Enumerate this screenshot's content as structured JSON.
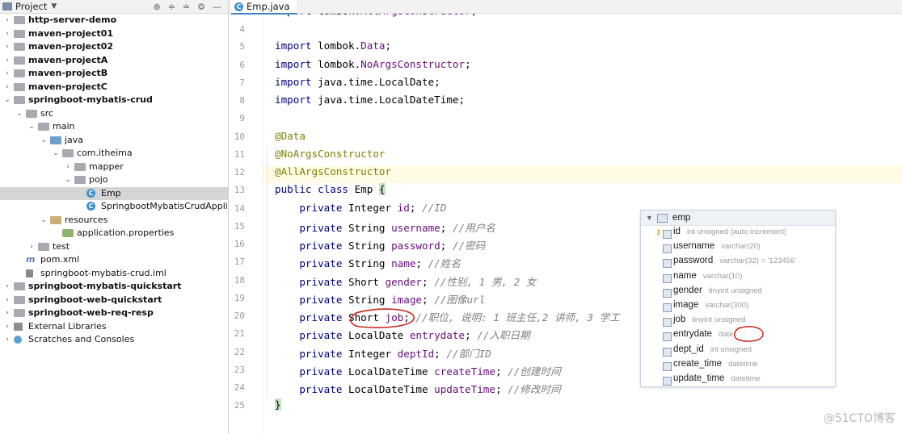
{
  "project_panel": {
    "title": "Project",
    "tree": [
      {
        "label": "http-server-demo",
        "bold": true,
        "icon": "folder-icon",
        "arrow": "right"
      },
      {
        "label": "maven-project01",
        "bold": true,
        "icon": "folder-icon",
        "arrow": "right"
      },
      {
        "label": "maven-project02",
        "bold": true,
        "icon": "folder-icon",
        "arrow": "right"
      },
      {
        "label": "maven-projectA",
        "bold": true,
        "icon": "folder-icon",
        "arrow": "right"
      },
      {
        "label": "maven-projectB",
        "bold": true,
        "icon": "folder-icon",
        "arrow": "right"
      },
      {
        "label": "maven-projectC",
        "bold": true,
        "icon": "folder-icon",
        "arrow": "right"
      },
      {
        "label": "springboot-mybatis-crud",
        "bold": true,
        "icon": "folder-icon",
        "arrow": "down"
      },
      {
        "label": "src",
        "icon": "folder-icon",
        "arrow": "down"
      },
      {
        "label": "main",
        "icon": "folder-icon",
        "arrow": "down"
      },
      {
        "label": "java",
        "icon": "source-folder-icon",
        "arrow": "down"
      },
      {
        "label": "com.itheima",
        "icon": "package-icon",
        "arrow": "down"
      },
      {
        "label": "mapper",
        "icon": "package-icon",
        "arrow": "right"
      },
      {
        "label": "pojo",
        "icon": "package-icon",
        "arrow": "down"
      },
      {
        "label": "Emp",
        "icon": "class-icon",
        "arrow": "",
        "selected": true
      },
      {
        "label": "SpringbootMybatisCrudApplication",
        "icon": "class-icon",
        "arrow": ""
      },
      {
        "label": "resources",
        "icon": "resources-folder-icon",
        "arrow": "down"
      },
      {
        "label": "application.properties",
        "icon": "properties-file-icon",
        "arrow": ""
      },
      {
        "label": "test",
        "icon": "folder-icon",
        "arrow": "right"
      },
      {
        "label": "pom.xml",
        "icon": "maven-file-icon",
        "arrow": ""
      },
      {
        "label": "springboot-mybatis-crud.iml",
        "icon": "iml-file-icon",
        "arrow": ""
      },
      {
        "label": "springboot-mybatis-quickstart",
        "bold": true,
        "icon": "folder-icon",
        "arrow": "right"
      },
      {
        "label": "springboot-web-quickstart",
        "bold": true,
        "icon": "folder-icon",
        "arrow": "right"
      },
      {
        "label": "springboot-web-req-resp",
        "bold": true,
        "icon": "folder-icon",
        "arrow": "right"
      },
      {
        "label": "External Libraries",
        "icon": "library-icon",
        "arrow": "right"
      },
      {
        "label": "Scratches and Consoles",
        "icon": "scratch-icon",
        "arrow": "right"
      }
    ]
  },
  "editor": {
    "tab_label": "Emp.java",
    "line_numbers": [
      "4",
      "5",
      "6",
      "7",
      "8",
      "9",
      "10",
      "11",
      "12",
      "13",
      "14",
      "15",
      "16",
      "17",
      "18",
      "19",
      "20",
      "21",
      "22",
      "23",
      "24",
      "25"
    ],
    "lines": [
      [
        {
          "t": "import lombok.",
          "c": "kw0"
        },
        {
          "t": "AllArgsConstructor",
          "c": "pk"
        },
        {
          "t": ";",
          "c": ""
        }
      ],
      [
        {
          "t": "import",
          "c": "kw"
        },
        {
          "t": " lombok.",
          "c": ""
        },
        {
          "t": "Data",
          "c": "pk"
        },
        {
          "t": ";",
          "c": ""
        }
      ],
      [
        {
          "t": "import",
          "c": "kw"
        },
        {
          "t": " lombok.",
          "c": ""
        },
        {
          "t": "NoArgsConstructor",
          "c": "pk"
        },
        {
          "t": ";",
          "c": ""
        }
      ],
      [
        {
          "t": "import",
          "c": "kw"
        },
        {
          "t": " java.time.LocalDate;",
          "c": ""
        }
      ],
      [
        {
          "t": "import",
          "c": "kw"
        },
        {
          "t": " java.time.LocalDateTime;",
          "c": ""
        }
      ],
      [],
      [
        {
          "t": "@Data",
          "c": "ann"
        }
      ],
      [
        {
          "t": "@NoArgsConstructor",
          "c": "ann"
        }
      ],
      [
        {
          "t": "@AllArgsConstructor",
          "c": "ann"
        }
      ],
      [
        {
          "t": "public class",
          "c": "kw"
        },
        {
          "t": " Emp ",
          "c": ""
        },
        {
          "t": "{",
          "c": "brace-hl"
        }
      ],
      [
        {
          "t": "    private",
          "c": "kw"
        },
        {
          "t": " Integer ",
          "c": ""
        },
        {
          "t": "id",
          "c": "fld"
        },
        {
          "t": "; ",
          "c": ""
        },
        {
          "t": "//ID",
          "c": "cmt"
        }
      ],
      [
        {
          "t": "    private",
          "c": "kw"
        },
        {
          "t": " String ",
          "c": ""
        },
        {
          "t": "username",
          "c": "fld"
        },
        {
          "t": "; ",
          "c": ""
        },
        {
          "t": "//用户名",
          "c": "cmt"
        }
      ],
      [
        {
          "t": "    private",
          "c": "kw"
        },
        {
          "t": " String ",
          "c": ""
        },
        {
          "t": "password",
          "c": "fld"
        },
        {
          "t": "; ",
          "c": ""
        },
        {
          "t": "//密码",
          "c": "cmt"
        }
      ],
      [
        {
          "t": "    private",
          "c": "kw"
        },
        {
          "t": " String ",
          "c": ""
        },
        {
          "t": "name",
          "c": "fld"
        },
        {
          "t": "; ",
          "c": ""
        },
        {
          "t": "//姓名",
          "c": "cmt"
        }
      ],
      [
        {
          "t": "    private",
          "c": "kw"
        },
        {
          "t": " Short ",
          "c": ""
        },
        {
          "t": "gender",
          "c": "fld"
        },
        {
          "t": "; ",
          "c": ""
        },
        {
          "t": "//性别, 1 男, 2 女",
          "c": "cmt"
        }
      ],
      [
        {
          "t": "    private",
          "c": "kw"
        },
        {
          "t": " String ",
          "c": ""
        },
        {
          "t": "image",
          "c": "fld"
        },
        {
          "t": "; ",
          "c": ""
        },
        {
          "t": "//图像url",
          "c": "cmt"
        }
      ],
      [
        {
          "t": "    private",
          "c": "kw"
        },
        {
          "t": " Short ",
          "c": ""
        },
        {
          "t": "job",
          "c": "fld"
        },
        {
          "t": "; ",
          "c": ""
        },
        {
          "t": "//职位, 说明: 1 班主任,2 讲师, 3 学工",
          "c": "cmt"
        }
      ],
      [
        {
          "t": "    private",
          "c": "kw"
        },
        {
          "t": " LocalDate ",
          "c": ""
        },
        {
          "t": "entrydate",
          "c": "fld"
        },
        {
          "t": "; ",
          "c": ""
        },
        {
          "t": "//入职日期",
          "c": "cmt"
        }
      ],
      [
        {
          "t": "    private",
          "c": "kw"
        },
        {
          "t": " Integer ",
          "c": ""
        },
        {
          "t": "deptId",
          "c": "fld"
        },
        {
          "t": "; ",
          "c": ""
        },
        {
          "t": "//部门ID",
          "c": "cmt"
        }
      ],
      [
        {
          "t": "    private",
          "c": "kw"
        },
        {
          "t": " LocalDateTime ",
          "c": ""
        },
        {
          "t": "createTime",
          "c": "fld"
        },
        {
          "t": "; ",
          "c": ""
        },
        {
          "t": "//创建时间",
          "c": "cmt"
        }
      ],
      [
        {
          "t": "    private",
          "c": "kw"
        },
        {
          "t": " LocalDateTime ",
          "c": ""
        },
        {
          "t": "updateTime",
          "c": "fld"
        },
        {
          "t": "; ",
          "c": ""
        },
        {
          "t": "//修改时间",
          "c": "cmt"
        }
      ],
      [
        {
          "t": "}",
          "c": "brace-hl"
        }
      ]
    ]
  },
  "emp_table": {
    "name": "emp",
    "columns": [
      {
        "name": "id",
        "type": "int unsigned (auto increment)",
        "key": true
      },
      {
        "name": "username",
        "type": "varchar(20)"
      },
      {
        "name": "password",
        "type": "varchar(32) = '123456'"
      },
      {
        "name": "name",
        "type": "varchar(10)"
      },
      {
        "name": "gender",
        "type": "tinyint unsigned"
      },
      {
        "name": "image",
        "type": "varchar(300)"
      },
      {
        "name": "job",
        "type": "tinyint unsigned"
      },
      {
        "name": "entrydate",
        "type": "date"
      },
      {
        "name": "dept_id",
        "type": "int unsigned"
      },
      {
        "name": "create_time",
        "type": "datetime"
      },
      {
        "name": "update_time",
        "type": "datetime"
      }
    ]
  },
  "watermark": "@51CTO博客",
  "colors": {
    "keyword": "#000080",
    "annotation": "#808000",
    "field": "#660e7a",
    "comment": "#808080",
    "annotation_marks": "#c8281e"
  }
}
